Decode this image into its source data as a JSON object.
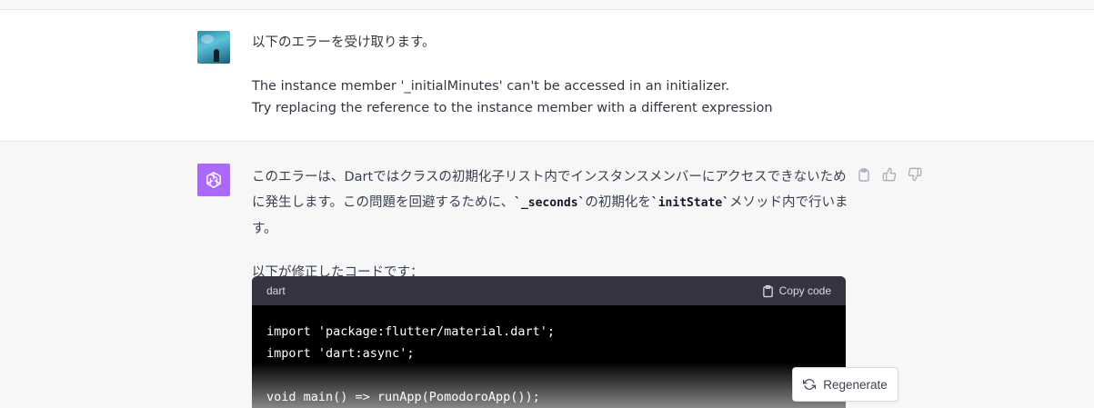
{
  "user_message": {
    "line1": "以下のエラーを受け取ります。",
    "line2": "The instance member '_initialMinutes' can't be accessed in an initializer.",
    "line3": "Try replacing the reference to the instance member with a different expression"
  },
  "assistant_message": {
    "p1_before": "このエラーは、Dartではクラスの初期化子リスト内でインスタンスメンバーにアクセスできないために発生します。この問題を回避するために、",
    "p1_code1": "`_seconds`",
    "p1_middle": "の初期化を",
    "p1_code2": "`initState`",
    "p1_after": "メソッド内で行います。",
    "p2": "以下が修正したコードです："
  },
  "code_block": {
    "language": "dart",
    "copy_label": "Copy code",
    "lines": [
      "import 'package:flutter/material.dart';",
      "import 'dart:async';",
      "",
      "void main() => runApp(PomodoroApp());"
    ]
  },
  "regenerate_label": "Regenerate",
  "icons": {
    "copy": "clipboard-icon",
    "like": "thumbs-up-icon",
    "dislike": "thumbs-down-icon",
    "regenerate": "refresh-icon",
    "assistant": "openai-logo-icon"
  },
  "colors": {
    "assistant_avatar": "#ab68ff",
    "code_bg": "#000000",
    "code_header_bg": "#343541"
  }
}
